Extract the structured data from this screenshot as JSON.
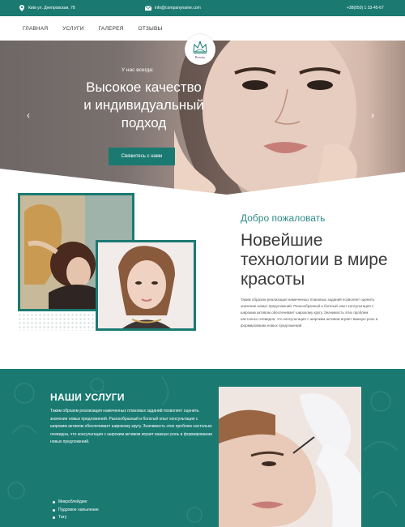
{
  "topbar": {
    "address": "Київ ул. Днепровская, 78",
    "email": "info@companyname.com",
    "phone": "+38(050) 1 33-45-67"
  },
  "nav": {
    "items": [
      "ГЛАВНАЯ",
      "УСЛУГИ",
      "ГАЛЕРЕЯ",
      "ОТЗЫВЫ"
    ]
  },
  "logo": {
    "text": "Beauty"
  },
  "hero": {
    "kicker": "У нас всегда:",
    "title_line1": "Высокое качество",
    "title_line2": "и индивидуальный",
    "title_line3": "подход",
    "button": "Свяжитесь с нами",
    "prev": "‹",
    "next": "›"
  },
  "welcome": {
    "kicker": "Добро пожаловать",
    "title": "Новейшие технологии в мире красоты",
    "text": "Таким образом реализация намеченных плановых заданий позволяет оценить значение новых предложений. Разнообразный и богатый опыт консультация с широким активом обеспечивает широкому кругу. Значимость этих проблем настолько очевидна, что консультация с широким активом играет важную роль в формировании новых предложений."
  },
  "services": {
    "title": "НАШИ УСЛУГИ",
    "text": "Таким образом реализация намеченных плановых заданий позволяет оценить значение новых предложений. Разнообразный и богатый опыт консультация с широким активом обеспечивает широкому кругу. Значимость этих проблем настолько очевидна, что консультация с широким активом играет важную роль в формировании новых предложений.",
    "list": [
      "Микроблейдинг",
      "Пудровое напыление",
      "Тату"
    ]
  },
  "colors": {
    "accent": "#1a7a72"
  }
}
